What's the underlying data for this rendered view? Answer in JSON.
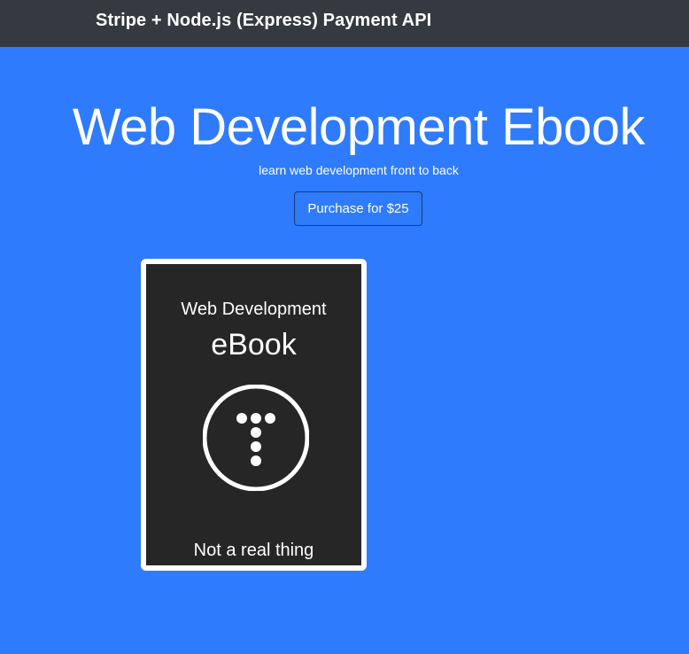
{
  "navbar": {
    "brand": "Stripe + Node.js (Express) Payment API"
  },
  "hero": {
    "title": "Web Development Ebook",
    "subtitle": "learn web development front to back",
    "purchase_label": "Purchase for $25"
  },
  "ebook_cover": {
    "top_text": "Web Development",
    "main_text": "eBook",
    "logo_icon": "t-dots-circle-icon",
    "footer_text": "Not a real thing"
  },
  "colors": {
    "page_background": "#2f7bfd",
    "navbar_background": "#343a40",
    "cover_background": "#262626",
    "cover_border": "#ffffff"
  }
}
